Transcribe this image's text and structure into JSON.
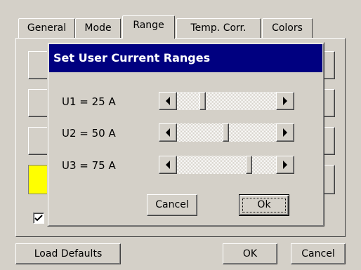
{
  "tabs": [
    {
      "label": "General",
      "active": false
    },
    {
      "label": "Mode",
      "active": false
    },
    {
      "label": "Range",
      "active": true
    },
    {
      "label": "Temp. Corr.",
      "active": false
    },
    {
      "label": "Colors",
      "active": false
    }
  ],
  "panel": {
    "swatch_color": "#ffff00",
    "checkbox_checked": true
  },
  "dialog": {
    "title": "Set User Current Ranges",
    "ranges": [
      {
        "label": "U1 = 25 A",
        "slider_fraction": 0.24
      },
      {
        "label": "U2 = 50 A",
        "slider_fraction": 0.49
      },
      {
        "label": "U3 = 75 A",
        "slider_fraction": 0.74
      }
    ],
    "cancel_label": "Cancel",
    "ok_label": "Ok"
  },
  "footer": {
    "load_defaults_label": "Load Defaults",
    "ok_label": "OK",
    "cancel_label": "Cancel"
  },
  "colors": {
    "titlebar": "#000080",
    "window": "#d4d0c8"
  }
}
